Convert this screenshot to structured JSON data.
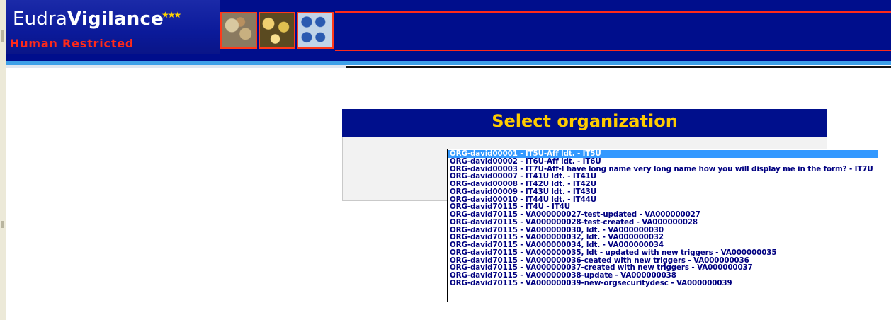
{
  "header": {
    "logo_part1": "Eudra",
    "logo_part2": "Vigilance",
    "logo_subtitle": "Human Restricted"
  },
  "panel": {
    "title": "Select organization"
  },
  "organizations": {
    "selected_index": 0,
    "options": [
      "ORG-david00001 - IT5U-Aff ldt. - IT5U",
      "ORG-david00002 - IT6U-Aff ldt. - IT6U",
      "ORG-david00003 - IT7U-Aff-I have long name very long name how you will display me in the form? - IT7U",
      "ORG-david00007 - IT41U ldt. - IT41U",
      "ORG-david00008 - IT42U ldt. - IT42U",
      "ORG-david00009 - IT43U ldt. - IT43U",
      "ORG-david00010 - IT44U ldt. - IT44U",
      "ORG-david70115 - IT4U - IT4U",
      "ORG-david70115 - VA000000027-test-updated - VA000000027",
      "ORG-david70115 - VA000000028-test-created - VA000000028",
      "ORG-david70115 - VA000000030, ldt. - VA000000030",
      "ORG-david70115 - VA000000032, ldt. - VA000000032",
      "ORG-david70115 - VA000000034, ldt. - VA000000034",
      "ORG-david70115 - VA000000035, ldt - updated with new triggers - VA000000035",
      "ORG-david70115 - VA000000036-ceated with new triggers - VA000000036",
      "ORG-david70115 - VA000000037-created with new triggers - VA000000037",
      "ORG-david70115 - VA000000038-update - VA000000038",
      "ORG-david70115 - VA000000039-new-orgsecuritydesc - VA000000039"
    ]
  },
  "colors": {
    "header_bg": "#000e8c",
    "title_text": "#ffcc00",
    "subtitle_red": "#ff2a1a",
    "selection": "#3399ff",
    "option_text": "#000080"
  }
}
